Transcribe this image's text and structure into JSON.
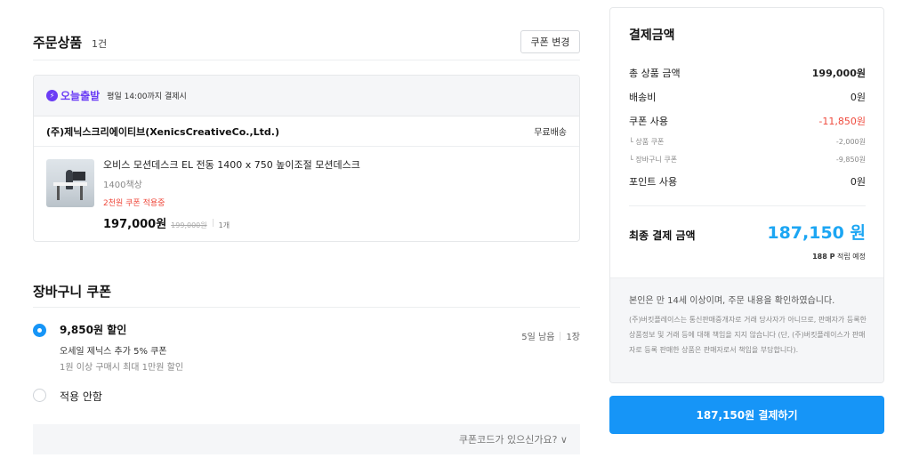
{
  "order": {
    "title": "주문상품",
    "count": "1건",
    "coupon_change_label": "쿠폰 변경",
    "today_badge": "오늘출발",
    "today_desc": "평일 14:00까지 결제시",
    "seller": "(주)제닉스크리에이티브(XenicsCreativeCo.,Ltd.)",
    "shipping": "무료배송",
    "product": {
      "name": "오비스 모션데스크 EL 전동 1400 x 750 높이조절 모션데스크",
      "option": "1400책상",
      "coupon_note": "2천원 쿠폰 적용중",
      "price": "197,000원",
      "original_price": "199,000원",
      "quantity": "1개"
    }
  },
  "cart_coupon": {
    "title": "장바구니 쿠폰",
    "selected": {
      "amount": "9,850원 할인",
      "name": "오세일 제닉스 추가 5% 쿠폰",
      "condition": "1원 이상 구매시 최대 1만원 할인",
      "days_left": "5일 남음",
      "count": "1장"
    },
    "no_apply_label": "적용 안함",
    "code_link": "쿠폰코드가 있으신가요? ∨"
  },
  "payment": {
    "title": "결제금액",
    "total_label": "총 상품 금액",
    "total_value": "199,000원",
    "shipping_label": "배송비",
    "shipping_value": "0원",
    "coupon_label": "쿠폰 사용",
    "coupon_value": "-11,850원",
    "product_coupon_label": "└ 상품 쿠폰",
    "product_coupon_value": "-2,000원",
    "cart_coupon_label": "└ 장바구니 쿠폰",
    "cart_coupon_value": "-9,850원",
    "point_label": "포인트 사용",
    "point_value": "0원",
    "final_label": "최종 결제 금액",
    "final_value": "187,150 원",
    "points_earn": "188 P",
    "points_earn_suffix": "적립 예정",
    "agree_text": "본인은 만 14세 이상이며, 주문 내용을 확인하였습니다.",
    "notice": "(주)버킷플레이스는 통신판매중개자로 거래 당사자가 아니므로, 판매자가 등록한 상품정보 및 거래 등에 대해 책임을 지지 않습니다 (단, (주)버킷플레이스가 판매자로 등록 판매한 상품은 판매자로서 책임을 부담합니다).",
    "pay_button": "187,150원 결제하기"
  },
  "colors": {
    "accent": "#1695f7",
    "price_accent": "#1ca6f3",
    "discount": "#ef4a3d",
    "today_purple": "#6b3df5"
  }
}
